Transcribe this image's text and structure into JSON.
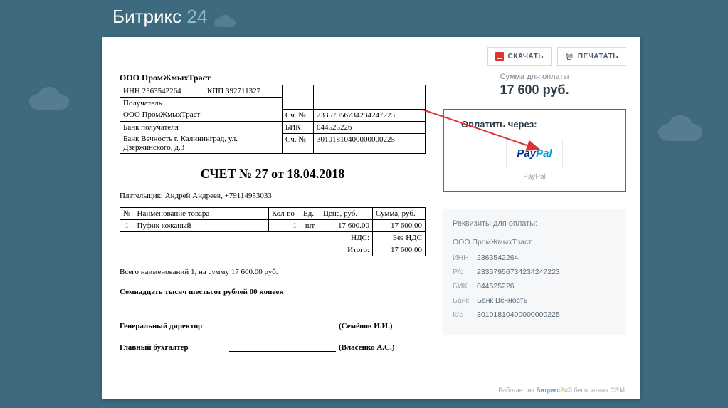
{
  "brand": {
    "part1": "Битрикс",
    "part2": "24"
  },
  "buttons": {
    "download": "СКАЧАТЬ",
    "print": "ПЕЧАТАТЬ"
  },
  "org": {
    "name": "ООО ПромЖмыхТраст",
    "inn_label": "ИНН 2363542264",
    "kpp_label": "КПП 392711327",
    "recipient_label": "Получатель",
    "recipient": "ООО ПромЖмыхТраст",
    "acct_label": "Сч. №",
    "acct": "23357956734234247223",
    "bank_label": "Банк получателя",
    "bank": "Банк Вечность г. Калининград, ул. Дзержинского, д.3",
    "bik_label": "БИК",
    "bik": "044525226",
    "bank_acct_label": "Сч. №",
    "bank_acct": "30101810400000000225"
  },
  "invoice_title": "СЧЕТ № 27 от 18.04.2018",
  "payer": "Плательщик: Андрей Андреев, +79114953033",
  "items": {
    "headers": {
      "num": "№",
      "name": "Наименование товара",
      "qty": "Кол-во",
      "unit": "Ед.",
      "price": "Цена, руб.",
      "sum": "Сумма, руб."
    },
    "rows": [
      {
        "num": "1",
        "name": "Пуфик кожаный",
        "qty": "1",
        "unit": "шт",
        "price": "17 600.00",
        "sum": "17 600.00"
      }
    ],
    "vat_label": "НДС:",
    "vat_value": "Без НДС",
    "total_label": "Итого:",
    "total_value": "17 600.00"
  },
  "summary_line": "Всего наименований 1, на сумму 17 600.00 руб.",
  "summary_words": "Семнадцать тысяч шестьсот рублей 00 копеек",
  "signatures": {
    "director_role": "Генеральный директор",
    "director_name": "(Семёнов И.И.)",
    "accountant_role": "Главный бухгалтер",
    "accountant_name": "(Власенко А.С.)"
  },
  "side": {
    "sum_label": "Сумма для оплаты",
    "sum_value": "17 600 руб.",
    "pay_title": "Оплатить через:",
    "paypal": "PayPal",
    "paypal_caption": "PayPal",
    "req_title": "Реквизиты для оплаты:",
    "req_org": "ООО ПромЖмыхТраст",
    "rows": [
      {
        "k": "ИНН",
        "v": "2363542264"
      },
      {
        "k": "Р/с",
        "v": "23357956734234247223"
      },
      {
        "k": "БИК",
        "v": "044525226"
      },
      {
        "k": "Банк",
        "v": "Банк Вечность"
      },
      {
        "k": "К/с",
        "v": "30101810400000000225"
      }
    ]
  },
  "footer": {
    "prefix": "Работает на ",
    "brand1": "Битрикс",
    "brand2": "24",
    "copy": "©",
    "suffix": " бесплатная CRM"
  }
}
